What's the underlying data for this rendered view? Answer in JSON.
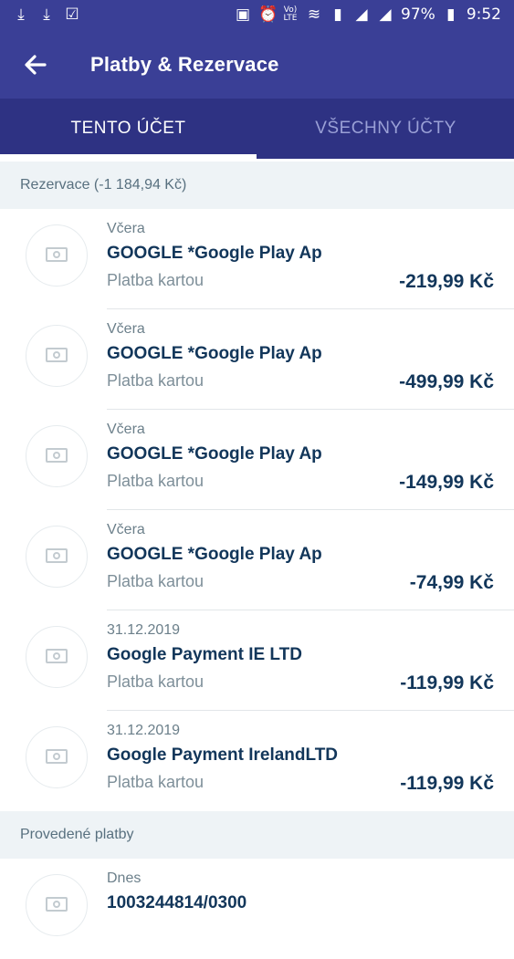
{
  "statusbar": {
    "left_icons": [
      "download-icon",
      "download-icon",
      "checkbox-icon"
    ],
    "right_icons": [
      "nfc-icon",
      "alarm-icon",
      "volte-icon",
      "wifi-icon",
      "sim-icon",
      "signal-icon",
      "signal-icon"
    ],
    "battery": "97%",
    "time": "9:52"
  },
  "appbar": {
    "title": "Platby & Rezervace"
  },
  "tabs": [
    {
      "label": "TENTO ÚČET",
      "active": true
    },
    {
      "label": "VŠECHNY ÚČTY",
      "active": false
    }
  ],
  "sections": [
    {
      "header": "Rezervace (-1 184,94 Kč)",
      "items": [
        {
          "date": "Včera",
          "merchant": "GOOGLE *Google Play Ap",
          "type": "Platba kartou",
          "amount": "-219,99 Kč"
        },
        {
          "date": "Včera",
          "merchant": "GOOGLE *Google Play Ap",
          "type": "Platba kartou",
          "amount": "-499,99 Kč"
        },
        {
          "date": "Včera",
          "merchant": "GOOGLE *Google Play Ap",
          "type": "Platba kartou",
          "amount": "-149,99 Kč"
        },
        {
          "date": "Včera",
          "merchant": "GOOGLE *Google Play Ap",
          "type": "Platba kartou",
          "amount": "-74,99 Kč"
        },
        {
          "date": "31.12.2019",
          "merchant": "Google Payment IE LTD",
          "type": "Platba kartou",
          "amount": "-119,99 Kč"
        },
        {
          "date": "31.12.2019",
          "merchant": "Google Payment IrelandLTD",
          "type": "Platba kartou",
          "amount": "-119,99 Kč"
        }
      ]
    },
    {
      "header": "Provedené platby",
      "items": [
        {
          "date": "Dnes",
          "merchant": "1003244814/0300"
        }
      ]
    }
  ],
  "colors": {
    "primary": "#3a3f96",
    "tabbar": "#2e3283",
    "text_dark": "#12365a"
  }
}
